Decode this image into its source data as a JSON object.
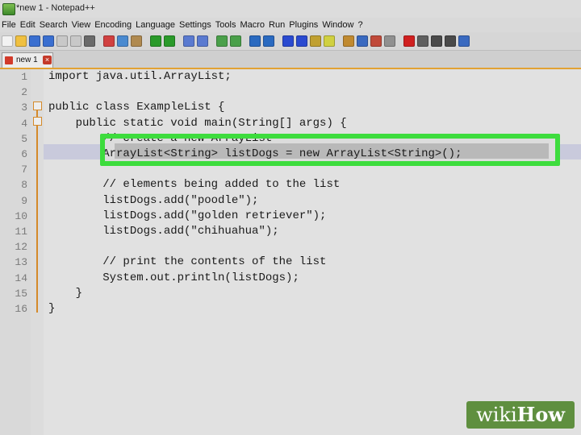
{
  "window": {
    "title": "*new 1 - Notepad++"
  },
  "menu": [
    "File",
    "Edit",
    "Search",
    "View",
    "Encoding",
    "Language",
    "Settings",
    "Tools",
    "Macro",
    "Run",
    "Plugins",
    "Window",
    "?"
  ],
  "toolbar": {
    "icons": [
      "new-file-icon",
      "open-file-icon",
      "save-icon",
      "save-all-icon",
      "close-icon",
      "close-all-icon",
      "print-icon",
      "cut-icon",
      "copy-icon",
      "paste-icon",
      "undo-icon",
      "redo-icon",
      "find-icon",
      "replace-icon",
      "zoom-in-icon",
      "zoom-out-icon",
      "sync-v-icon",
      "sync-h-icon",
      "word-wrap-icon",
      "show-all-icon",
      "indent-guide-icon",
      "lang-icon",
      "doc-map-icon",
      "function-list-icon",
      "folder-icon",
      "monitor-icon",
      "record-icon",
      "stop-icon",
      "play-icon",
      "play-multi-icon",
      "save-macro-icon"
    ],
    "colors": [
      "#f2f2f2",
      "#f0c040",
      "#3a6fd0",
      "#3a6fd0",
      "#c8c8c8",
      "#c8c8c8",
      "#6a6a6a",
      "#d04040",
      "#4a8ad0",
      "#b08a50",
      "#2a9a2a",
      "#2a9a2a",
      "#5a7ad0",
      "#5a7ad0",
      "#4aa04a",
      "#4aa04a",
      "#2a6ac0",
      "#2a6ac0",
      "#2a4ad0",
      "#2a4ad0",
      "#c0a030",
      "#d0d040",
      "#c08a30",
      "#3a6ac0",
      "#c04a3a",
      "#909090",
      "#d02020",
      "#606060",
      "#4a4a4a",
      "#4a4a4a",
      "#3a6ac0"
    ]
  },
  "tab": {
    "label": "new 1",
    "close": "×"
  },
  "editor": {
    "lines": [
      {
        "num": "1",
        "code": "import java.util.ArrayList;"
      },
      {
        "num": "2",
        "code": ""
      },
      {
        "num": "3",
        "code": "public class ExampleList {"
      },
      {
        "num": "4",
        "code": "    public static void main(String[] args) {"
      },
      {
        "num": "5",
        "code": "        // create a new ArrayList"
      },
      {
        "num": "6",
        "code": "        ArrayList<String> listDogs = new ArrayList<String>();"
      },
      {
        "num": "7",
        "code": ""
      },
      {
        "num": "8",
        "code": "        // elements being added to the list"
      },
      {
        "num": "9",
        "code": "        listDogs.add(\"poodle\");"
      },
      {
        "num": "10",
        "code": "        listDogs.add(\"golden retriever\");"
      },
      {
        "num": "11",
        "code": "        listDogs.add(\"chihuahua\");"
      },
      {
        "num": "12",
        "code": ""
      },
      {
        "num": "13",
        "code": "        // print the contents of the list"
      },
      {
        "num": "14",
        "code": "        System.out.println(listDogs);"
      },
      {
        "num": "15",
        "code": "    }"
      },
      {
        "num": "16",
        "code": "}"
      }
    ]
  },
  "watermark": {
    "part1": "wiki",
    "part2": "How"
  },
  "colors": {
    "highlight": "#3ddc3d",
    "fold": "#d58a2a",
    "accent": "#e2a233"
  }
}
